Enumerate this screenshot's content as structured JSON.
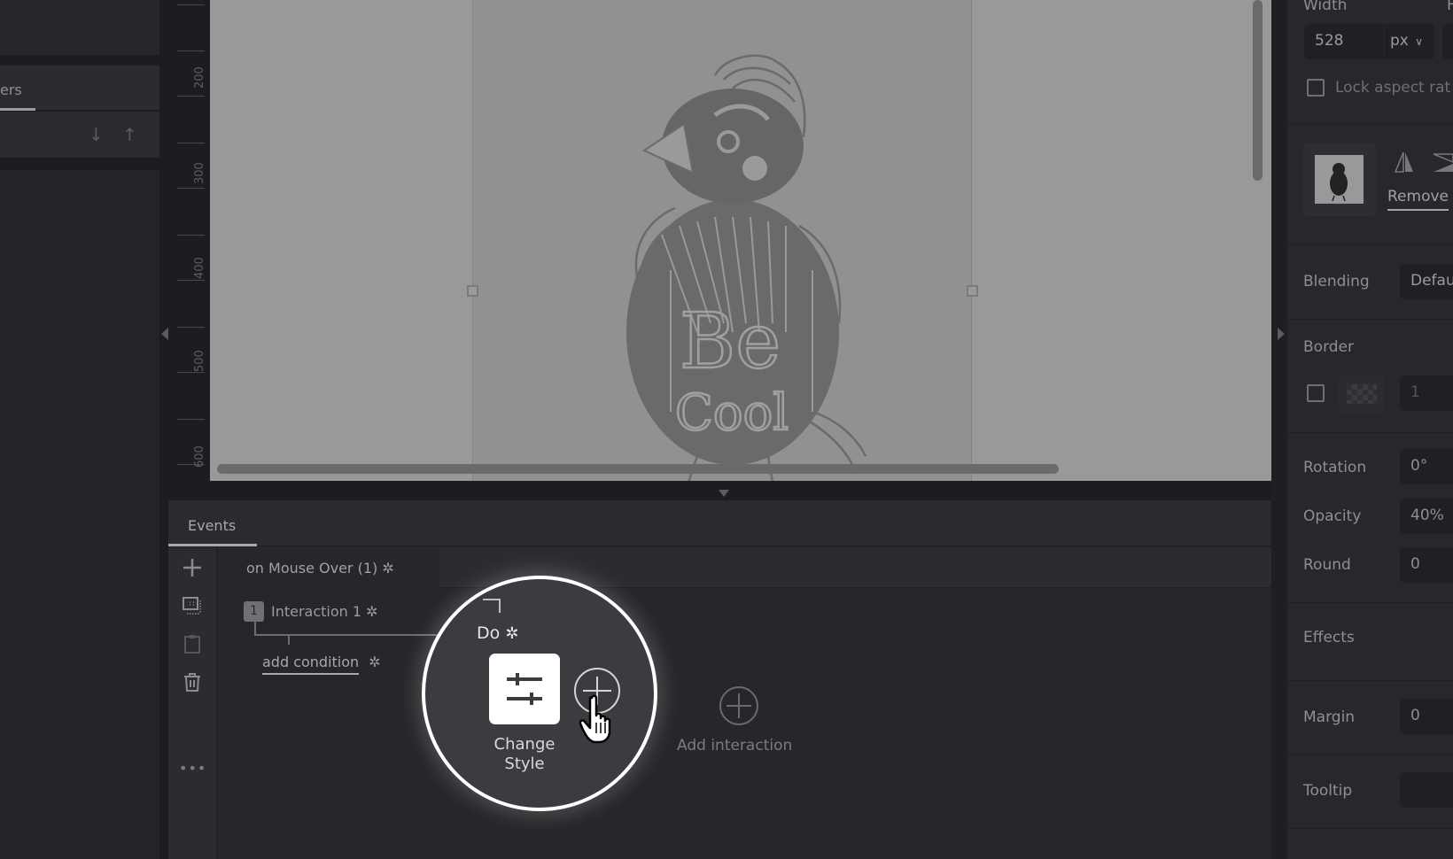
{
  "left_panel": {
    "tab_label": "ers",
    "move_down_icon": "↓",
    "move_up_icon": "↑"
  },
  "ruler": {
    "labels": [
      "200",
      "300",
      "400",
      "500",
      "600"
    ]
  },
  "canvas": {
    "image_text": [
      "Be",
      "Cool"
    ]
  },
  "events": {
    "tab_label": "Events",
    "event_name": "on Mouse Over (1)",
    "interaction_number": "1",
    "interaction_label": "Interaction 1",
    "add_condition_label": "add condition",
    "do_label": "Do",
    "action_label_line1": "Change",
    "action_label_line2": "Style",
    "add_interaction_label": "Add interaction",
    "tools": [
      "plus-icon",
      "select-area-icon",
      "paste-icon",
      "trash-icon",
      "more-icon"
    ],
    "more_glyph": "•••",
    "gear_glyph": "✲"
  },
  "properties": {
    "width_label": "Width",
    "height_label_partial": "H",
    "width_value": "528",
    "width_unit": "px",
    "lock_aspect_label": "Lock aspect rat",
    "remove_label": "Remove",
    "blending_label": "Blending",
    "blending_value": "Defau",
    "border_label": "Border",
    "border_width": "1",
    "rotation_label": "Rotation",
    "rotation_value": "0°",
    "opacity_label": "Opacity",
    "opacity_value": "40%",
    "round_label": "Round",
    "round_value": "0",
    "effects_label": "Effects",
    "margin_label": "Margin",
    "margin_value": "0",
    "tooltip_label": "Tooltip",
    "tooltip_value": ""
  }
}
